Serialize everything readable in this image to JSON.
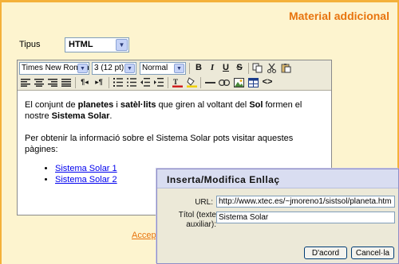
{
  "panel": {
    "title": "Material addicional",
    "type_label": "Tipus",
    "type_value": "HTML",
    "accept_link": "Accept"
  },
  "toolbar": {
    "font_family": "Times New Roman",
    "font_size": "3 (12 pt)",
    "paragraph_format": "Normal",
    "bold_label": "B",
    "italic_label": "I",
    "underline_label": "U",
    "strike_label": "S",
    "rtl_label": "¶◂",
    "ltr_label": "▸¶"
  },
  "content": {
    "p1_a": "El conjunt de ",
    "p1_b": "planetes",
    "p1_c": " i ",
    "p1_d": "satèl·lits",
    "p1_e": " que giren al voltant del ",
    "p1_f": "Sol",
    "p1_g": " formen el nostre ",
    "p1_h": "Sistema Solar",
    "p1_i": ".",
    "p2": "Per obtenir la informació sobre el Sistema Solar pots visitar aquestes pàgines:",
    "links": [
      "Sistema Solar 1",
      "Sistema Solar 2"
    ]
  },
  "dialog": {
    "title": "Inserta/Modifica Enllaç",
    "url_label": "URL:",
    "url_value": "http://www.xtec.es/~jmoreno1/sistsol/planeta.htm",
    "title_label_line1": "Títol (texte",
    "title_label_line2": "auxiliar):",
    "title_value": "Sistema Solar",
    "ok_label": "D'acord",
    "cancel_label": "Cancel·la"
  }
}
